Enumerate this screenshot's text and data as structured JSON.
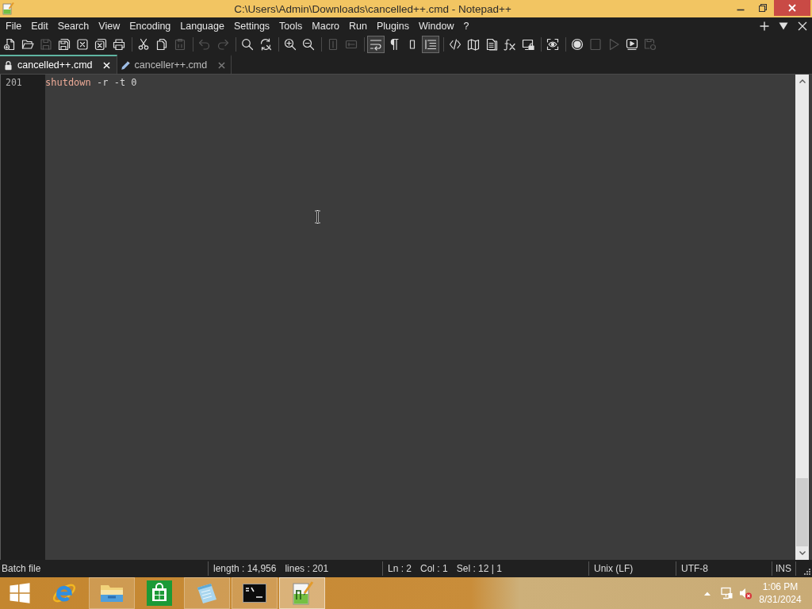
{
  "window": {
    "title": "C:\\Users\\Admin\\Downloads\\cancelled++.cmd - Notepad++"
  },
  "menu": [
    "File",
    "Edit",
    "Search",
    "View",
    "Encoding",
    "Language",
    "Settings",
    "Tools",
    "Macro",
    "Run",
    "Plugins",
    "Window",
    "?"
  ],
  "toolbar": [
    {
      "buttons": [
        {
          "kind": "new",
          "disabled": false,
          "pressed": false
        },
        {
          "kind": "open",
          "disabled": false,
          "pressed": false
        },
        {
          "kind": "save",
          "disabled": true,
          "pressed": false
        },
        {
          "kind": "saveall",
          "disabled": false,
          "pressed": false
        },
        {
          "kind": "close",
          "disabled": false,
          "pressed": false
        },
        {
          "kind": "closeall",
          "disabled": false,
          "pressed": false
        },
        {
          "kind": "print",
          "disabled": false,
          "pressed": false
        }
      ]
    },
    {
      "buttons": [
        {
          "kind": "cut",
          "disabled": false,
          "pressed": false
        },
        {
          "kind": "copy",
          "disabled": false,
          "pressed": false
        },
        {
          "kind": "paste",
          "disabled": true,
          "pressed": false
        }
      ]
    },
    {
      "buttons": [
        {
          "kind": "undo",
          "disabled": true,
          "pressed": false
        },
        {
          "kind": "redo",
          "disabled": true,
          "pressed": false
        }
      ]
    },
    {
      "buttons": [
        {
          "kind": "find",
          "disabled": false,
          "pressed": false
        },
        {
          "kind": "replace",
          "disabled": false,
          "pressed": false
        }
      ]
    },
    {
      "buttons": [
        {
          "kind": "zoomin",
          "disabled": false,
          "pressed": false
        },
        {
          "kind": "zoomout",
          "disabled": false,
          "pressed": false
        }
      ]
    },
    {
      "buttons": [
        {
          "kind": "syncv",
          "disabled": true,
          "pressed": false
        },
        {
          "kind": "synch",
          "disabled": true,
          "pressed": false
        }
      ]
    },
    {
      "buttons": [
        {
          "kind": "wrap",
          "disabled": false,
          "pressed": true
        },
        {
          "kind": "allchars",
          "disabled": false,
          "pressed": false
        },
        {
          "kind": "indent",
          "disabled": false,
          "pressed": false
        },
        {
          "kind": "outline",
          "disabled": false,
          "pressed": true
        }
      ]
    },
    {
      "buttons": [
        {
          "kind": "udl",
          "disabled": false,
          "pressed": false
        },
        {
          "kind": "docmap",
          "disabled": false,
          "pressed": false
        },
        {
          "kind": "doclist",
          "disabled": false,
          "pressed": false
        },
        {
          "kind": "funclist",
          "disabled": false,
          "pressed": false
        },
        {
          "kind": "workspace",
          "disabled": false,
          "pressed": false
        }
      ]
    },
    {
      "buttons": [
        {
          "kind": "monitor",
          "disabled": false,
          "pressed": false
        }
      ]
    },
    {
      "buttons": [
        {
          "kind": "record",
          "disabled": false,
          "pressed": false
        },
        {
          "kind": "stop",
          "disabled": true,
          "pressed": false
        },
        {
          "kind": "play",
          "disabled": true,
          "pressed": false
        },
        {
          "kind": "playmulti",
          "disabled": false,
          "pressed": false
        },
        {
          "kind": "savemacro",
          "disabled": true,
          "pressed": false
        }
      ]
    }
  ],
  "tabs": [
    {
      "label": "cancelled++.cmd",
      "kind": "locked",
      "selected": true
    },
    {
      "label": "canceller++.cmd",
      "kind": "edited",
      "selected": false
    }
  ],
  "editor": {
    "lines": [
      {
        "number": "201",
        "tokens": [
          {
            "text": "shutdown",
            "kind": "command"
          },
          {
            "text": " -r -t 0",
            "kind": "plain"
          }
        ]
      }
    ]
  },
  "status_bar": {
    "sections": [
      [
        "Batch file"
      ],
      [
        "length : 14,956",
        "lines : 201"
      ],
      [
        "Ln : 2",
        "Col : 1",
        "Sel : 12 | 1"
      ],
      [
        "Unix (LF)"
      ],
      [
        "UTF-8"
      ],
      [
        "INS"
      ]
    ]
  },
  "taskbar": {
    "apps": [
      {
        "kind": "browser",
        "running": false,
        "selected": false
      },
      {
        "kind": "explorer",
        "running": true,
        "selected": false
      },
      {
        "kind": "store",
        "running": false,
        "selected": false
      },
      {
        "kind": "notes",
        "running": true,
        "selected": false
      },
      {
        "kind": "cmd",
        "running": true,
        "selected": false
      },
      {
        "kind": "editor",
        "running": true,
        "selected": true
      }
    ],
    "clock": {
      "time": "1:06 PM",
      "date": "8/31/2024"
    }
  }
}
